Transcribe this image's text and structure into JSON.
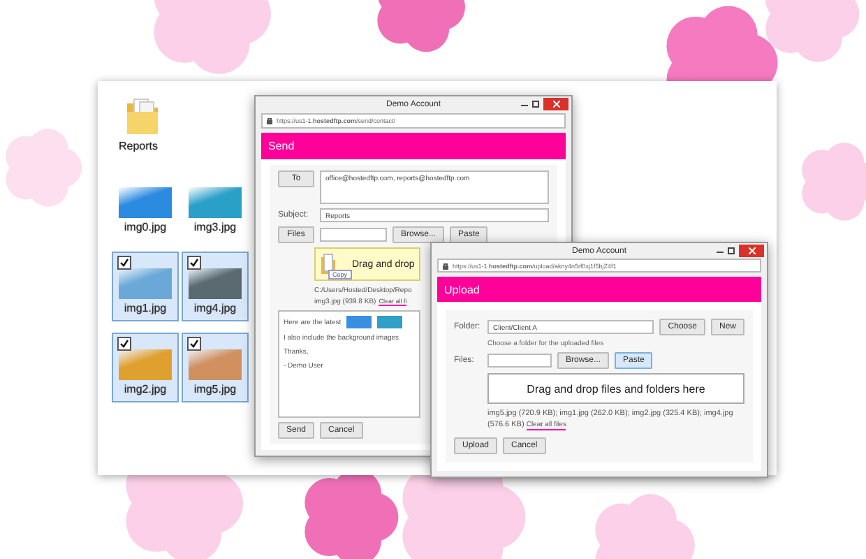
{
  "explorer": {
    "items": [
      {
        "kind": "folder",
        "label": "Reports",
        "selected": false,
        "checked": false
      },
      {
        "kind": "photo",
        "label": "img0.jpg",
        "selected": false,
        "checked": false,
        "color": "#2a8be0"
      },
      {
        "kind": "photo",
        "label": "img3.jpg",
        "selected": false,
        "checked": false,
        "color": "#2aa0c8"
      },
      {
        "kind": "photo",
        "label": "img1.jpg",
        "selected": true,
        "checked": true,
        "color": "#6aa8d8"
      },
      {
        "kind": "photo",
        "label": "img4.jpg",
        "selected": true,
        "checked": true,
        "color": "#5a6a70"
      },
      {
        "kind": "photo",
        "label": "img2.jpg",
        "selected": true,
        "checked": true,
        "color": "#e0a030"
      },
      {
        "kind": "photo",
        "label": "img5.jpg",
        "selected": true,
        "checked": true,
        "color": "#d09060"
      }
    ]
  },
  "send_window": {
    "title": "Demo Account",
    "url_host": "https://us1-1.",
    "url_domain": "hostedftp.com",
    "url_path": "/send/contact/",
    "header": "Send",
    "to_button": "To",
    "to_value": "office@hostedftp.com, reports@hostedftp.com",
    "subject_label": "Subject:",
    "subject_value": "Reports",
    "files_button": "Files",
    "browse_button": "Browse...",
    "paste_button": "Paste",
    "drop_text": "Drag and drop",
    "drag_badge": "Copy",
    "path_text": "C:/Users/Hosted/Desktop/Repo",
    "file_text": "img3.jpg (939.8 KB)",
    "clear_link": "Clear all fi",
    "message_lines": [
      "Here are the latest",
      "I also include the background images",
      "Thanks,",
      "- Demo User"
    ],
    "buttons": [
      "Send",
      "Cancel"
    ]
  },
  "upload_window": {
    "title": "Demo Account",
    "url_host": "https://us1-1.",
    "url_domain": "hostedftp.com",
    "url_path": "/upload/akny4n5rf0xj1f5bjZ4f1",
    "header": "Upload",
    "folder_label": "Folder:",
    "folder_value": "Client/Client A",
    "choose_button": "Choose",
    "new_button": "New",
    "folder_hint": "Choose a folder for the uploaded files",
    "files_label": "Files:",
    "browse_button": "Browse...",
    "paste_button": "Paste",
    "paste_selected": true,
    "drop_text": "Drag and drop files and folders here",
    "file_list": "img5.jpg (720.9 KB); img1.jpg (262.0 KB); img2.jpg (325.4 KB); img4.jpg (576.6 KB)",
    "clear_link": "Clear all files",
    "buttons": [
      "Upload",
      "Cancel"
    ]
  }
}
